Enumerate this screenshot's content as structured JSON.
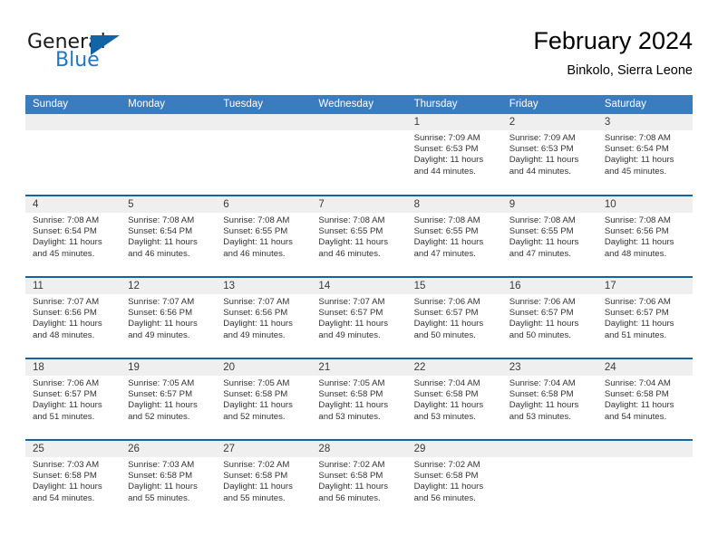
{
  "brand": {
    "word1": "General",
    "word2": "Blue",
    "triangle_color": "#1364a5",
    "blue_color": "#1f77c4"
  },
  "header": {
    "title": "February 2024",
    "subtitle": "Binkolo, Sierra Leone"
  },
  "theme": {
    "header_bg": "#3b7cbf",
    "row_divider": "#1364a5",
    "daynum_bg": "#efefef"
  },
  "weekdays": [
    "Sunday",
    "Monday",
    "Tuesday",
    "Wednesday",
    "Thursday",
    "Friday",
    "Saturday"
  ],
  "weeks": [
    [
      {
        "day": "",
        "lines": []
      },
      {
        "day": "",
        "lines": []
      },
      {
        "day": "",
        "lines": []
      },
      {
        "day": "",
        "lines": []
      },
      {
        "day": "1",
        "lines": [
          "Sunrise: 7:09 AM",
          "Sunset: 6:53 PM",
          "Daylight: 11 hours and 44 minutes."
        ]
      },
      {
        "day": "2",
        "lines": [
          "Sunrise: 7:09 AM",
          "Sunset: 6:53 PM",
          "Daylight: 11 hours and 44 minutes."
        ]
      },
      {
        "day": "3",
        "lines": [
          "Sunrise: 7:08 AM",
          "Sunset: 6:54 PM",
          "Daylight: 11 hours and 45 minutes."
        ]
      }
    ],
    [
      {
        "day": "4",
        "lines": [
          "Sunrise: 7:08 AM",
          "Sunset: 6:54 PM",
          "Daylight: 11 hours and 45 minutes."
        ]
      },
      {
        "day": "5",
        "lines": [
          "Sunrise: 7:08 AM",
          "Sunset: 6:54 PM",
          "Daylight: 11 hours and 46 minutes."
        ]
      },
      {
        "day": "6",
        "lines": [
          "Sunrise: 7:08 AM",
          "Sunset: 6:55 PM",
          "Daylight: 11 hours and 46 minutes."
        ]
      },
      {
        "day": "7",
        "lines": [
          "Sunrise: 7:08 AM",
          "Sunset: 6:55 PM",
          "Daylight: 11 hours and 46 minutes."
        ]
      },
      {
        "day": "8",
        "lines": [
          "Sunrise: 7:08 AM",
          "Sunset: 6:55 PM",
          "Daylight: 11 hours and 47 minutes."
        ]
      },
      {
        "day": "9",
        "lines": [
          "Sunrise: 7:08 AM",
          "Sunset: 6:55 PM",
          "Daylight: 11 hours and 47 minutes."
        ]
      },
      {
        "day": "10",
        "lines": [
          "Sunrise: 7:08 AM",
          "Sunset: 6:56 PM",
          "Daylight: 11 hours and 48 minutes."
        ]
      }
    ],
    [
      {
        "day": "11",
        "lines": [
          "Sunrise: 7:07 AM",
          "Sunset: 6:56 PM",
          "Daylight: 11 hours and 48 minutes."
        ]
      },
      {
        "day": "12",
        "lines": [
          "Sunrise: 7:07 AM",
          "Sunset: 6:56 PM",
          "Daylight: 11 hours and 49 minutes."
        ]
      },
      {
        "day": "13",
        "lines": [
          "Sunrise: 7:07 AM",
          "Sunset: 6:56 PM",
          "Daylight: 11 hours and 49 minutes."
        ]
      },
      {
        "day": "14",
        "lines": [
          "Sunrise: 7:07 AM",
          "Sunset: 6:57 PM",
          "Daylight: 11 hours and 49 minutes."
        ]
      },
      {
        "day": "15",
        "lines": [
          "Sunrise: 7:06 AM",
          "Sunset: 6:57 PM",
          "Daylight: 11 hours and 50 minutes."
        ]
      },
      {
        "day": "16",
        "lines": [
          "Sunrise: 7:06 AM",
          "Sunset: 6:57 PM",
          "Daylight: 11 hours and 50 minutes."
        ]
      },
      {
        "day": "17",
        "lines": [
          "Sunrise: 7:06 AM",
          "Sunset: 6:57 PM",
          "Daylight: 11 hours and 51 minutes."
        ]
      }
    ],
    [
      {
        "day": "18",
        "lines": [
          "Sunrise: 7:06 AM",
          "Sunset: 6:57 PM",
          "Daylight: 11 hours and 51 minutes."
        ]
      },
      {
        "day": "19",
        "lines": [
          "Sunrise: 7:05 AM",
          "Sunset: 6:57 PM",
          "Daylight: 11 hours and 52 minutes."
        ]
      },
      {
        "day": "20",
        "lines": [
          "Sunrise: 7:05 AM",
          "Sunset: 6:58 PM",
          "Daylight: 11 hours and 52 minutes."
        ]
      },
      {
        "day": "21",
        "lines": [
          "Sunrise: 7:05 AM",
          "Sunset: 6:58 PM",
          "Daylight: 11 hours and 53 minutes."
        ]
      },
      {
        "day": "22",
        "lines": [
          "Sunrise: 7:04 AM",
          "Sunset: 6:58 PM",
          "Daylight: 11 hours and 53 minutes."
        ]
      },
      {
        "day": "23",
        "lines": [
          "Sunrise: 7:04 AM",
          "Sunset: 6:58 PM",
          "Daylight: 11 hours and 53 minutes."
        ]
      },
      {
        "day": "24",
        "lines": [
          "Sunrise: 7:04 AM",
          "Sunset: 6:58 PM",
          "Daylight: 11 hours and 54 minutes."
        ]
      }
    ],
    [
      {
        "day": "25",
        "lines": [
          "Sunrise: 7:03 AM",
          "Sunset: 6:58 PM",
          "Daylight: 11 hours and 54 minutes."
        ]
      },
      {
        "day": "26",
        "lines": [
          "Sunrise: 7:03 AM",
          "Sunset: 6:58 PM",
          "Daylight: 11 hours and 55 minutes."
        ]
      },
      {
        "day": "27",
        "lines": [
          "Sunrise: 7:02 AM",
          "Sunset: 6:58 PM",
          "Daylight: 11 hours and 55 minutes."
        ]
      },
      {
        "day": "28",
        "lines": [
          "Sunrise: 7:02 AM",
          "Sunset: 6:58 PM",
          "Daylight: 11 hours and 56 minutes."
        ]
      },
      {
        "day": "29",
        "lines": [
          "Sunrise: 7:02 AM",
          "Sunset: 6:58 PM",
          "Daylight: 11 hours and 56 minutes."
        ]
      },
      {
        "day": "",
        "lines": []
      },
      {
        "day": "",
        "lines": []
      }
    ]
  ]
}
